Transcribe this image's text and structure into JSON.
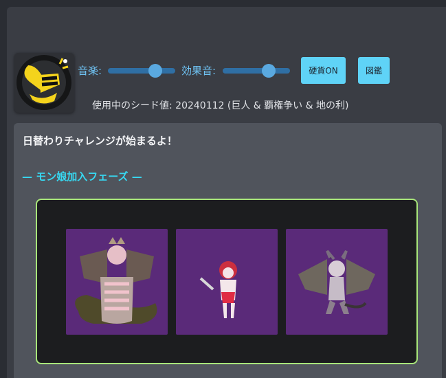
{
  "controls": {
    "music_label": "音楽:",
    "music_level": 0.7,
    "sfx_label": "効果音:",
    "sfx_level": 0.68,
    "coin_button": "硬貨ON",
    "encyclopedia_button": "図鑑"
  },
  "seed_text": "使用中のシード値: 20240112 (巨人 & 覇権争い & 地の利)",
  "main": {
    "message": "日替わりチャレンジが始まるよ！",
    "phase_title": "— モン娘加入フェーズ —",
    "monsters": [
      "dragon-girl-sprite",
      "red-haired-swordswoman-sprite",
      "winged-demon-girl-sprite"
    ]
  },
  "colors": {
    "accent": "#5fd3f7",
    "slider_label": "#6fc3f4",
    "phase_title": "#37d7f0",
    "stage_border": "#a8e67a",
    "tile_bg": "#5a2a79"
  }
}
